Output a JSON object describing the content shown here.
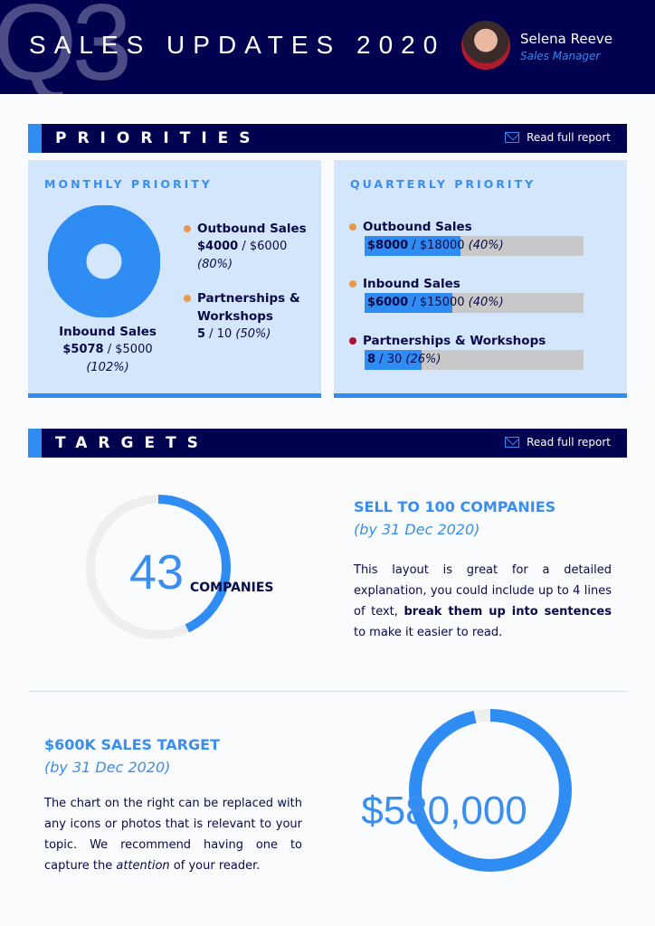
{
  "header": {
    "watermark": "Q3",
    "title": "SALES UPDATES 2020",
    "name": "Selena Reeve",
    "role": "Sales Manager"
  },
  "priorities": {
    "title": "PRIORITIES",
    "link": "Read full report",
    "monthly": {
      "heading": "MONTHLY PRIORITY",
      "main": {
        "label": "Inbound Sales",
        "value": "$5078",
        "target": " / $5000",
        "pct": "(102%)",
        "fraction": 1.02
      },
      "items": [
        {
          "label": "Outbound Sales",
          "value": "$4000",
          "target": " / $6000",
          "pct": "(80%)",
          "dot": "#e8994a"
        },
        {
          "label": "Partnerships &",
          "label2": "Workshops",
          "value": "5",
          "target": " / 10 ",
          "pct": "(50%)",
          "dot": "#e8994a"
        }
      ]
    },
    "quarterly": {
      "heading": "QUARTERLY PRIORITY",
      "items": [
        {
          "label": "Outbound Sales",
          "value": "$8000",
          "target": " / $18000 ",
          "pct": "(40%)",
          "fraction": 0.44,
          "dot": "#e8994a"
        },
        {
          "label": "Inbound Sales",
          "value": "$6000",
          "target": " / $15000 ",
          "pct": "(40%)",
          "fraction": 0.4,
          "dot": "#e8994a"
        },
        {
          "label": "Partnerships & Workshops",
          "value": "8",
          "target": " / 30 ",
          "pct": "(26%)",
          "fraction": 0.26,
          "dot": "#b0102a"
        }
      ]
    }
  },
  "targets": {
    "title": "TARGETS",
    "link": "Read full report",
    "companies": {
      "number": "43",
      "unit": "COMPANIES",
      "fraction": 0.43,
      "heading": "SELL TO 100 COMPANIES",
      "deadline": "(by 31 Dec 2020)",
      "text1": "This layout is great for a detailed explanation, you could include up to 4 lines of text, ",
      "bold": "break them up into sentences",
      "text2": " to make it easier to read."
    },
    "sales": {
      "heading": "$600K SALES TARGET",
      "deadline": "(by 31 Dec 2020)",
      "amount": "$580,000",
      "fraction": 0.967,
      "text1": "The chart on the right can be replaced with any icons or photos that is relevant to your topic. We recommend having one to capture the ",
      "em": "attention",
      "text2": " of your reader."
    }
  },
  "colors": {
    "navy": "#020150",
    "accent": "#2f8cf3",
    "panel": "#d3e6fb"
  }
}
